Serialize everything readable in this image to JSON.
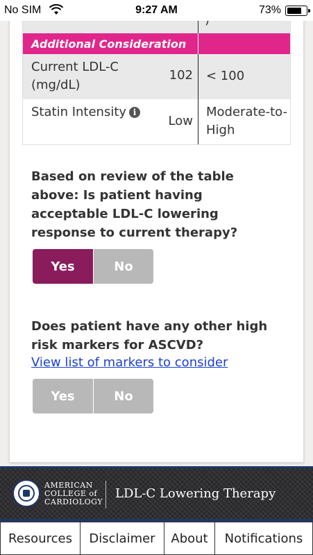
{
  "status_bar": {
    "carrier": "No SIM",
    "time": "9:27 AM",
    "battery": "73%"
  },
  "table": {
    "top_row_peek": ")",
    "section_header": "Additional Consideration",
    "rows": [
      {
        "label": "Current LDL-C (mg/dL)",
        "current": "102",
        "goal": "< 100"
      },
      {
        "label": "Statin Intensity",
        "current": "Low",
        "goal": "Moderate-to-High"
      }
    ]
  },
  "question1": {
    "text": "Based on review of the table above: Is patient having acceptable LDL-C lowering response to current therapy?",
    "yes_label": "Yes",
    "no_label": "No",
    "selected": "Yes"
  },
  "question2": {
    "text": "Does patient have any other high risk markers for ASCVD?",
    "link": "View list of markers to consider",
    "yes_label": "Yes",
    "no_label": "No",
    "selected": null
  },
  "brand": {
    "org_line1": "AMERICAN",
    "org_line2": "COLLEGE of",
    "org_line3": "CARDIOLOGY",
    "app_title": "LDL-C Lowering Therapy"
  },
  "tabs": [
    {
      "label": "Resources"
    },
    {
      "label": "Disclaimer"
    },
    {
      "label": "About"
    },
    {
      "label": "Notifications"
    }
  ],
  "colors": {
    "section_header": "#e1268b",
    "button_active": "#8a1c5c",
    "button_inactive": "#b8b8b8",
    "link": "#1a3fd6",
    "brand_border": "#1f3766"
  }
}
